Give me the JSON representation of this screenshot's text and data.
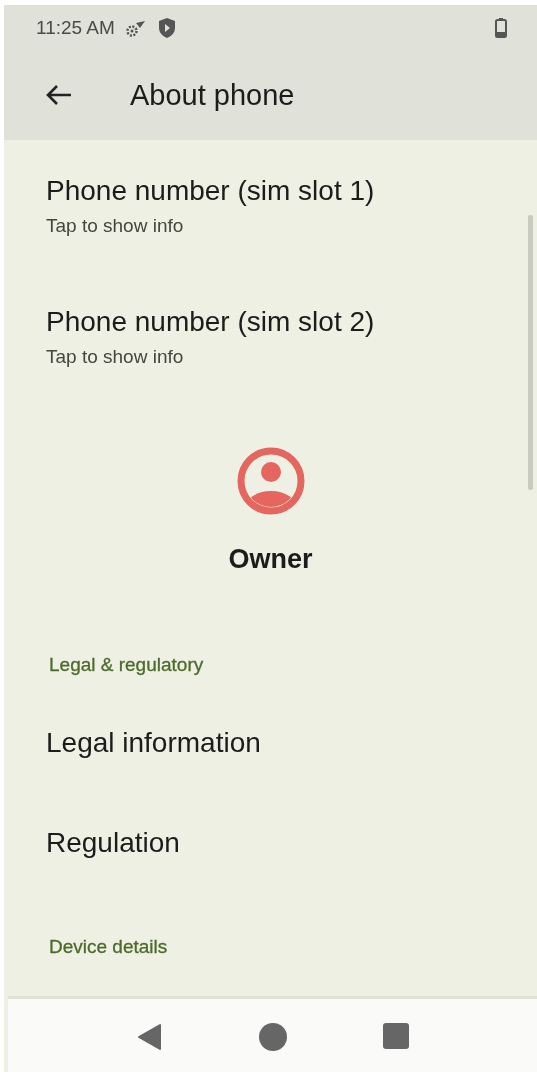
{
  "status_bar": {
    "time": "11:25 AM"
  },
  "app_bar": {
    "title": "About phone"
  },
  "items": [
    {
      "kind": "preference",
      "title": "Phone number (sim slot 1)",
      "summary": "Tap to show info"
    },
    {
      "kind": "preference",
      "title": "Phone number (sim slot 2)",
      "summary": "Tap to show info"
    },
    {
      "kind": "owner",
      "title": "Owner"
    },
    {
      "kind": "category",
      "title": "Legal & regulatory"
    },
    {
      "kind": "preference",
      "title": "Legal information"
    },
    {
      "kind": "preference",
      "title": "Regulation"
    },
    {
      "kind": "category",
      "title": "Device details"
    }
  ]
}
